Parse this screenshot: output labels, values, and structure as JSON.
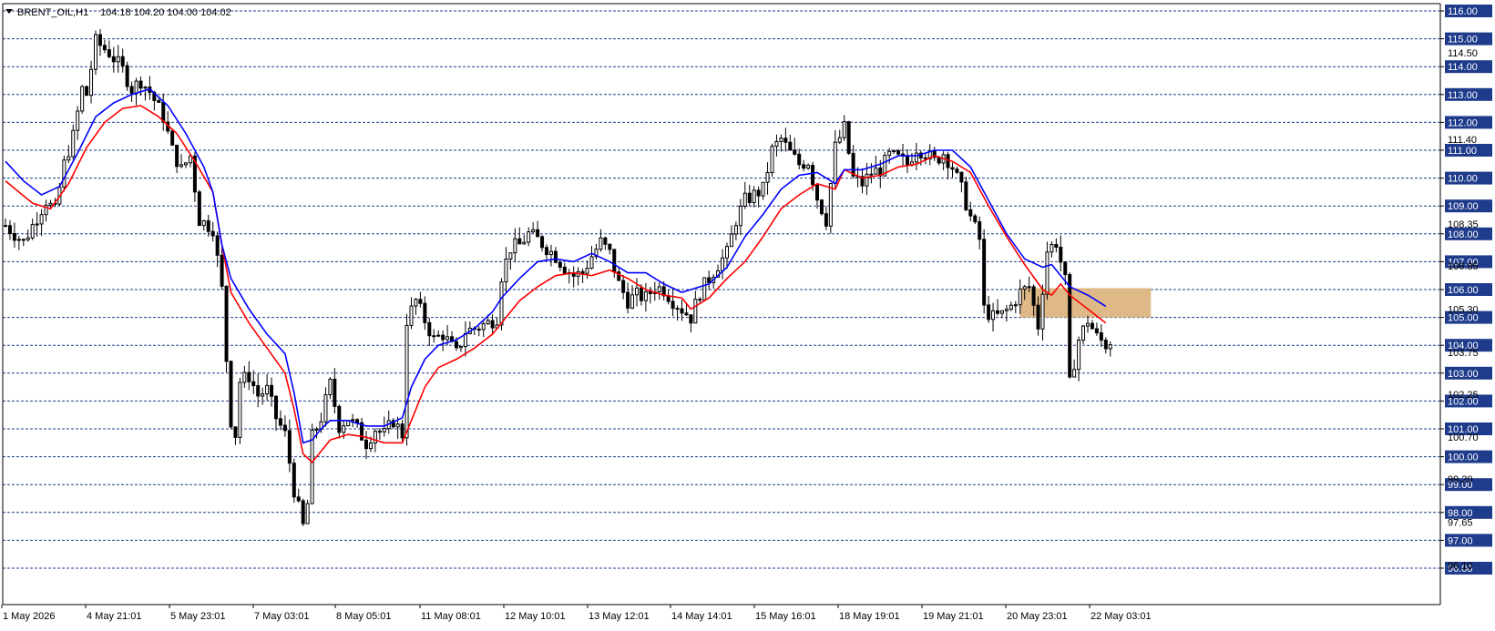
{
  "header": {
    "symbol": "BRENT_OIL,H1",
    "ohlc": "104.18 104.20 104.00 104.02"
  },
  "colors": {
    "background": "#ffffff",
    "grid": "#1f3c8c",
    "candle": "#000000",
    "ma_fast": "#ff0000",
    "ma_slow": "#0000ff",
    "zone": "#deb887",
    "badge": "#1f3c8c"
  },
  "chart_data": {
    "type": "candlestick",
    "title": "BRENT_OIL,H1",
    "ylim": [
      95.7,
      116.3
    ],
    "grid": true,
    "x_tick_labels": [
      "1 May 2026",
      "4 May 21:01",
      "5 May 23:01",
      "7 May 03:01",
      "8 May 05:01",
      "11 May 08:01",
      "12 May 10:01",
      "13 May 12:01",
      "14 May 14:01",
      "15 May 16:01",
      "18 May 19:01",
      "19 May 21:01",
      "20 May 23:01",
      "22 May 03:01"
    ],
    "y_levels": [
      96,
      97,
      98,
      99,
      100,
      101,
      102,
      103,
      104,
      105,
      106,
      107,
      108,
      109,
      110,
      111,
      112,
      113,
      114,
      115,
      116
    ],
    "y_axis_other_labels": [
      "114.50",
      "111.40",
      "108.35",
      "106.85",
      "105.30",
      "103.75",
      "102.25",
      "100.70",
      "99.20",
      "97.65",
      "96.10"
    ],
    "current_price": 104.02,
    "price_path": [
      [
        0,
        108.3
      ],
      [
        4,
        107.7
      ],
      [
        6,
        108.3
      ],
      [
        9,
        109.2
      ],
      [
        11,
        108.8
      ],
      [
        13,
        110.5
      ],
      [
        15,
        111.5
      ],
      [
        17,
        113.2
      ],
      [
        18,
        113.0
      ],
      [
        20,
        114.9
      ],
      [
        23,
        114.5
      ],
      [
        26,
        113.9
      ],
      [
        28,
        113.2
      ],
      [
        30,
        113.5
      ],
      [
        32,
        113.1
      ],
      [
        35,
        112.2
      ],
      [
        37,
        111.0
      ],
      [
        39,
        110.3
      ],
      [
        41,
        110.8
      ],
      [
        43,
        108.5
      ],
      [
        46,
        108.2
      ],
      [
        48,
        106.0
      ],
      [
        49,
        103.5
      ],
      [
        50,
        101.3
      ],
      [
        51,
        100.8
      ],
      [
        52,
        102.7
      ],
      [
        54,
        102.9
      ],
      [
        56,
        102.2
      ],
      [
        58,
        102.4
      ],
      [
        60,
        101.4
      ],
      [
        62,
        100.8
      ],
      [
        64,
        98.8
      ],
      [
        66,
        97.5
      ],
      [
        67,
        98.3
      ],
      [
        68,
        100.7
      ],
      [
        70,
        101.4
      ],
      [
        72,
        102.6
      ],
      [
        74,
        101.1
      ],
      [
        76,
        101.4
      ],
      [
        78,
        101.0
      ],
      [
        80,
        100.5
      ],
      [
        82,
        101.0
      ],
      [
        84,
        100.8
      ],
      [
        86,
        101.3
      ],
      [
        88,
        100.8
      ],
      [
        89,
        104.9
      ],
      [
        91,
        105.6
      ],
      [
        93,
        104.9
      ],
      [
        95,
        104.2
      ],
      [
        97,
        104.4
      ],
      [
        100,
        103.7
      ],
      [
        102,
        104.5
      ],
      [
        104,
        104.6
      ],
      [
        107,
        104.8
      ],
      [
        109,
        105.0
      ],
      [
        110,
        106.5
      ],
      [
        112,
        107.5
      ],
      [
        114,
        107.6
      ],
      [
        116,
        108.0
      ],
      [
        118,
        107.8
      ],
      [
        120,
        107.5
      ],
      [
        122,
        107.2
      ],
      [
        124,
        106.8
      ],
      [
        126,
        106.5
      ],
      [
        128,
        106.6
      ],
      [
        130,
        107.2
      ],
      [
        132,
        107.7
      ],
      [
        134,
        107.3
      ],
      [
        136,
        106.2
      ],
      [
        138,
        105.6
      ],
      [
        140,
        105.8
      ],
      [
        142,
        105.7
      ],
      [
        144,
        106.1
      ],
      [
        146,
        106.0
      ],
      [
        148,
        105.6
      ],
      [
        150,
        105.3
      ],
      [
        152,
        105.0
      ],
      [
        154,
        105.9
      ],
      [
        156,
        106.4
      ],
      [
        158,
        106.9
      ],
      [
        160,
        107.3
      ],
      [
        162,
        108.5
      ],
      [
        164,
        109.2
      ],
      [
        166,
        109.4
      ],
      [
        168,
        109.6
      ],
      [
        170,
        111.0
      ],
      [
        172,
        111.4
      ],
      [
        174,
        110.9
      ],
      [
        176,
        110.5
      ],
      [
        178,
        110.6
      ],
      [
        180,
        109.3
      ],
      [
        182,
        108.5
      ],
      [
        184,
        111.1
      ],
      [
        186,
        111.8
      ],
      [
        188,
        110.0
      ],
      [
        190,
        109.8
      ],
      [
        192,
        110.2
      ],
      [
        194,
        110.3
      ],
      [
        196,
        110.8
      ],
      [
        198,
        110.7
      ],
      [
        200,
        110.5
      ],
      [
        202,
        111.1
      ],
      [
        204,
        110.9
      ],
      [
        206,
        110.6
      ],
      [
        208,
        110.9
      ],
      [
        210,
        110.4
      ],
      [
        212,
        109.6
      ],
      [
        214,
        108.6
      ],
      [
        216,
        107.8
      ],
      [
        217,
        105.3
      ],
      [
        219,
        105.0
      ],
      [
        221,
        105.1
      ],
      [
        223,
        105.4
      ],
      [
        225,
        105.9
      ],
      [
        227,
        106.1
      ],
      [
        229,
        104.7
      ],
      [
        231,
        107.4
      ],
      [
        233,
        107.7
      ],
      [
        235,
        106.3
      ],
      [
        236,
        102.6
      ],
      [
        238,
        104.2
      ],
      [
        240,
        104.9
      ],
      [
        242,
        104.3
      ],
      [
        244,
        104.02
      ]
    ],
    "series": [
      {
        "name": "",
        "color": "#ff0000",
        "values": [
          [
            0,
            109.9
          ],
          [
            6,
            109.1
          ],
          [
            10,
            108.9
          ],
          [
            14,
            109.8
          ],
          [
            18,
            111.1
          ],
          [
            22,
            112.0
          ],
          [
            26,
            112.5
          ],
          [
            30,
            112.6
          ],
          [
            34,
            112.2
          ],
          [
            38,
            111.6
          ],
          [
            42,
            110.6
          ],
          [
            46,
            109.5
          ],
          [
            48,
            107.6
          ],
          [
            50,
            105.9
          ],
          [
            54,
            104.8
          ],
          [
            58,
            103.9
          ],
          [
            62,
            103.0
          ],
          [
            64,
            101.7
          ],
          [
            66,
            100.1
          ],
          [
            68,
            99.8
          ],
          [
            70,
            100.2
          ],
          [
            72,
            100.6
          ],
          [
            76,
            100.8
          ],
          [
            80,
            100.7
          ],
          [
            84,
            100.5
          ],
          [
            88,
            100.5
          ],
          [
            90,
            101.3
          ],
          [
            93,
            102.5
          ],
          [
            96,
            103.2
          ],
          [
            100,
            103.5
          ],
          [
            104,
            103.9
          ],
          [
            108,
            104.4
          ],
          [
            110,
            104.8
          ],
          [
            114,
            105.6
          ],
          [
            118,
            106.1
          ],
          [
            122,
            106.5
          ],
          [
            126,
            106.6
          ],
          [
            130,
            106.5
          ],
          [
            134,
            106.7
          ],
          [
            138,
            106.4
          ],
          [
            142,
            106.0
          ],
          [
            146,
            105.8
          ],
          [
            150,
            105.7
          ],
          [
            152,
            105.3
          ],
          [
            156,
            105.7
          ],
          [
            160,
            106.4
          ],
          [
            164,
            107.0
          ],
          [
            168,
            107.9
          ],
          [
            172,
            108.9
          ],
          [
            176,
            109.4
          ],
          [
            180,
            109.8
          ],
          [
            184,
            109.6
          ],
          [
            186,
            110.3
          ],
          [
            190,
            110.0
          ],
          [
            194,
            110.1
          ],
          [
            198,
            110.4
          ],
          [
            202,
            110.5
          ],
          [
            206,
            110.8
          ],
          [
            210,
            110.6
          ],
          [
            214,
            110.2
          ],
          [
            218,
            109.0
          ],
          [
            222,
            107.9
          ],
          [
            226,
            106.9
          ],
          [
            230,
            106.0
          ],
          [
            232,
            105.8
          ],
          [
            234,
            106.2
          ],
          [
            236,
            105.8
          ],
          [
            240,
            105.3
          ],
          [
            244,
            104.8
          ]
        ]
      },
      {
        "name": "",
        "color": "#0000ff",
        "values": [
          [
            0,
            110.6
          ],
          [
            4,
            109.9
          ],
          [
            8,
            109.4
          ],
          [
            12,
            109.7
          ],
          [
            16,
            110.9
          ],
          [
            20,
            112.2
          ],
          [
            24,
            112.7
          ],
          [
            28,
            113.0
          ],
          [
            32,
            113.2
          ],
          [
            36,
            112.6
          ],
          [
            40,
            111.6
          ],
          [
            44,
            110.4
          ],
          [
            46,
            109.5
          ],
          [
            48,
            107.6
          ],
          [
            50,
            106.4
          ],
          [
            54,
            105.3
          ],
          [
            58,
            104.4
          ],
          [
            62,
            103.7
          ],
          [
            64,
            102.3
          ],
          [
            66,
            100.5
          ],
          [
            68,
            100.6
          ],
          [
            70,
            101.0
          ],
          [
            72,
            101.3
          ],
          [
            76,
            101.3
          ],
          [
            80,
            101.1
          ],
          [
            84,
            101.1
          ],
          [
            88,
            101.4
          ],
          [
            90,
            102.5
          ],
          [
            93,
            103.5
          ],
          [
            96,
            104.0
          ],
          [
            100,
            104.2
          ],
          [
            104,
            104.6
          ],
          [
            108,
            105.2
          ],
          [
            110,
            105.7
          ],
          [
            114,
            106.4
          ],
          [
            118,
            107.0
          ],
          [
            122,
            107.1
          ],
          [
            126,
            107.0
          ],
          [
            130,
            107.3
          ],
          [
            134,
            107.0
          ],
          [
            138,
            106.6
          ],
          [
            142,
            106.6
          ],
          [
            146,
            106.2
          ],
          [
            150,
            105.9
          ],
          [
            152,
            106.0
          ],
          [
            156,
            106.2
          ],
          [
            160,
            106.8
          ],
          [
            164,
            107.9
          ],
          [
            168,
            108.7
          ],
          [
            172,
            109.6
          ],
          [
            176,
            110.1
          ],
          [
            180,
            110.2
          ],
          [
            184,
            109.8
          ],
          [
            186,
            110.3
          ],
          [
            190,
            110.3
          ],
          [
            194,
            110.5
          ],
          [
            198,
            110.8
          ],
          [
            202,
            110.8
          ],
          [
            206,
            111.0
          ],
          [
            210,
            111.0
          ],
          [
            214,
            110.4
          ],
          [
            218,
            109.2
          ],
          [
            222,
            108.0
          ],
          [
            226,
            107.1
          ],
          [
            230,
            106.8
          ],
          [
            232,
            106.9
          ],
          [
            234,
            106.5
          ],
          [
            236,
            106.1
          ],
          [
            240,
            105.8
          ],
          [
            244,
            105.4
          ]
        ]
      }
    ],
    "zone": {
      "from_bar": 225,
      "to_bar": 254,
      "top": 106.05,
      "bottom": 105.0
    }
  }
}
